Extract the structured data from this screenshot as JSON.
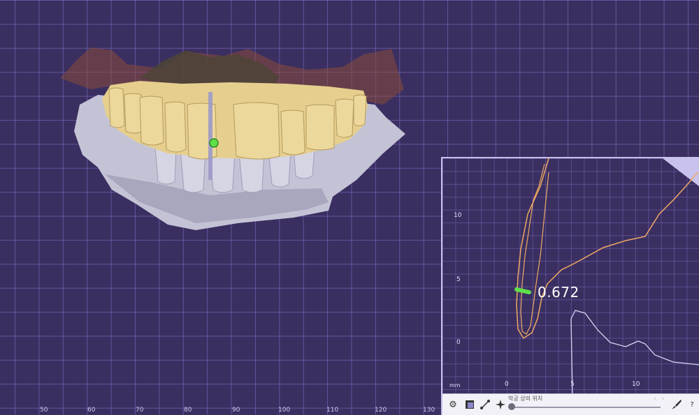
{
  "viewport": {
    "x_scale_labels": [
      "50",
      "60",
      "70",
      "80",
      "90",
      "100",
      "110",
      "120",
      "130"
    ]
  },
  "section_view": {
    "y_labels": [
      "10",
      "5",
      "0"
    ],
    "x_labels": [
      "0",
      "5",
      "10"
    ],
    "unit": "mm",
    "measurement_value": "0.672"
  },
  "toolbar": {
    "slider_caption": "악궁 상의 위치",
    "prev_label": "‹",
    "next_label": "›",
    "help_label": "?",
    "icons": [
      "gear-icon",
      "clip-view-icon",
      "measure-line-icon",
      "point-icon",
      "brush-icon"
    ]
  },
  "colors": {
    "background": "#3a2f60",
    "grid": "#8f7ee0",
    "tooth_crown": "#e6cf8e",
    "gum_model": "#c4c3d6",
    "profile_line": "#f0a964",
    "measure_marker": "#5fe04a"
  }
}
